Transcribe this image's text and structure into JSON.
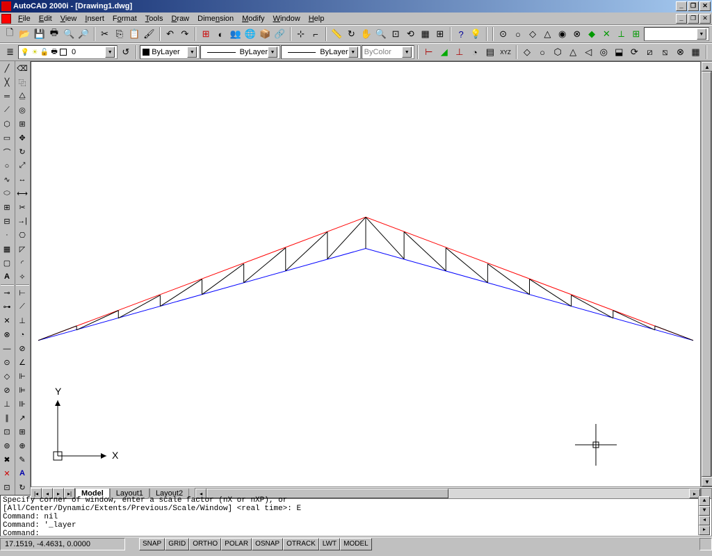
{
  "app": {
    "title": "AutoCAD 2000i - [Drawing1.dwg]"
  },
  "menu": {
    "items": [
      "File",
      "Edit",
      "View",
      "Insert",
      "Format",
      "Tools",
      "Draw",
      "Dimension",
      "Modify",
      "Window",
      "Help"
    ]
  },
  "props": {
    "layer_name": "0",
    "color_label": "ByLayer",
    "linetype_label": "ByLayer",
    "lineweight_label": "ByLayer",
    "plotstyle_label": "ByColor"
  },
  "tabs": {
    "model": "Model",
    "layout1": "Layout1",
    "layout2": "Layout2"
  },
  "ucs": {
    "x": "X",
    "y": "Y"
  },
  "cmd": {
    "line1": "Specify corner of window, enter a scale factor (nX or nXP), or",
    "line2": "[All/Center/Dynamic/Extents/Previous/Scale/Window] <real time>: E",
    "line3": "Command: nil",
    "line4": "Command: '_layer",
    "prompt": "Command:"
  },
  "status": {
    "coords": "17.1519, -4.4631, 0.0000",
    "snap": "SNAP",
    "grid": "GRID",
    "ortho": "ORTHO",
    "polar": "POLAR",
    "osnap": "OSNAP",
    "otrack": "OTRACK",
    "lwt": "LWT",
    "model": "MODEL"
  }
}
